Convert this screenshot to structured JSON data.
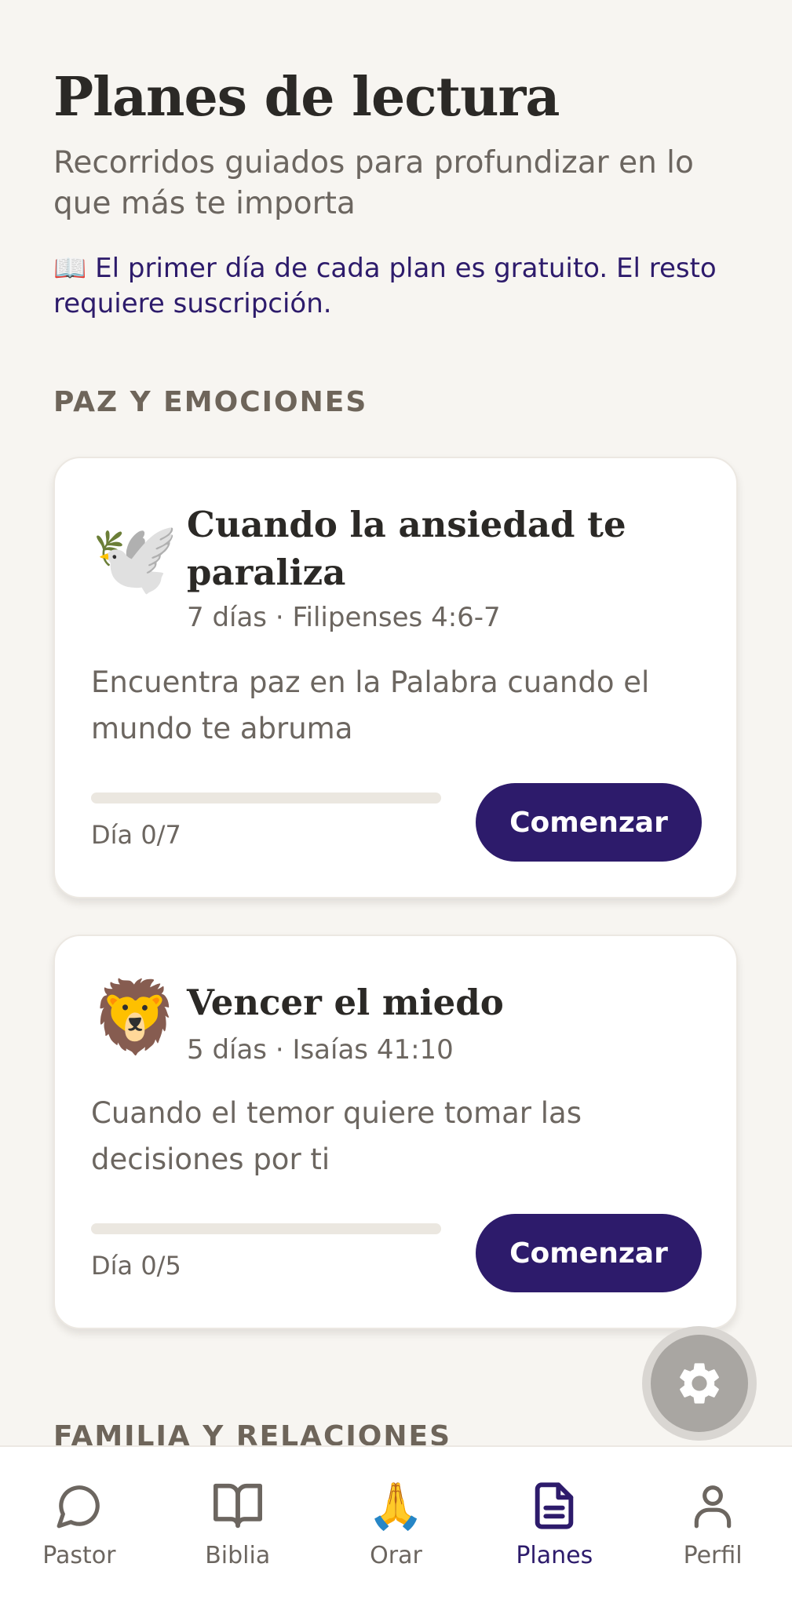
{
  "header": {
    "title": "Planes de lectura",
    "subtitle": "Recorridos guiados para profundizar en lo que más te importa",
    "notice": "📖 El primer día de cada plan es gratuito. El resto requiere suscripción."
  },
  "sections": [
    {
      "title": "PAZ Y EMOCIONES",
      "plans": [
        {
          "emoji": "🕊️",
          "title": "Cuando la ansiedad te paraliza",
          "meta": "7 días · Filipenses 4:6-7",
          "description": "Encuentra paz en la Palabra cuando el mundo te abruma",
          "progress": 0,
          "day_label": "Día 0/7",
          "button": "Comenzar"
        },
        {
          "emoji": "🦁",
          "title": "Vencer el miedo",
          "meta": "5 días · Isaías 41:10",
          "description": "Cuando el temor quiere tomar las decisiones por ti",
          "progress": 0,
          "day_label": "Día 0/5",
          "button": "Comenzar"
        }
      ]
    },
    {
      "title": "FAMILIA Y RELACIONES"
    }
  ],
  "fab": {
    "icon": "gear-icon"
  },
  "tabbar": {
    "items": [
      {
        "label": "Pastor",
        "icon": "chat-bubble-icon"
      },
      {
        "label": "Biblia",
        "icon": "open-book-icon"
      },
      {
        "label": "Orar",
        "icon": "praying-hands-icon",
        "emoji": "🙏"
      },
      {
        "label": "Planes",
        "icon": "document-icon",
        "active": true
      },
      {
        "label": "Perfil",
        "icon": "user-icon"
      }
    ]
  },
  "colors": {
    "background": "#f7f5f1",
    "accent": "#2d1b6b",
    "muted_text": "#6c6660",
    "section_text": "#6e655a"
  }
}
